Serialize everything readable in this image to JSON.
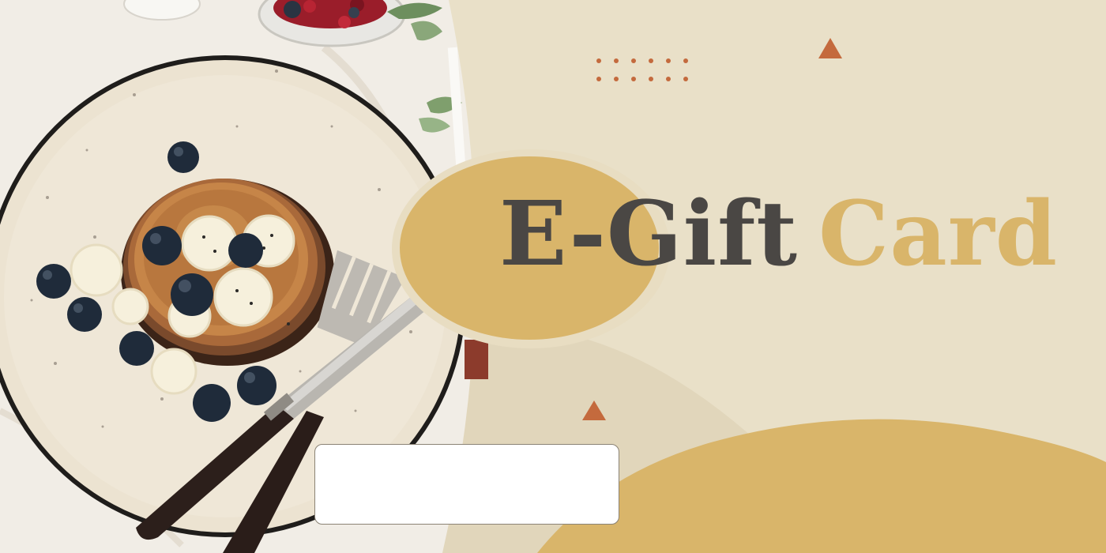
{
  "card": {
    "title_part1": "E-Gift",
    "title_part2": "Card",
    "code_value": ""
  },
  "colors": {
    "background": "#e9e0c8",
    "gold_accent": "#d9b56a",
    "terracotta_accent": "#c46a3d",
    "title_dark": "#4a4744",
    "plate": "#ece3d1"
  },
  "icons": {
    "photo": "pancakes-plate-photo",
    "decor": [
      "dot-grid",
      "triangle",
      "triangle"
    ]
  }
}
